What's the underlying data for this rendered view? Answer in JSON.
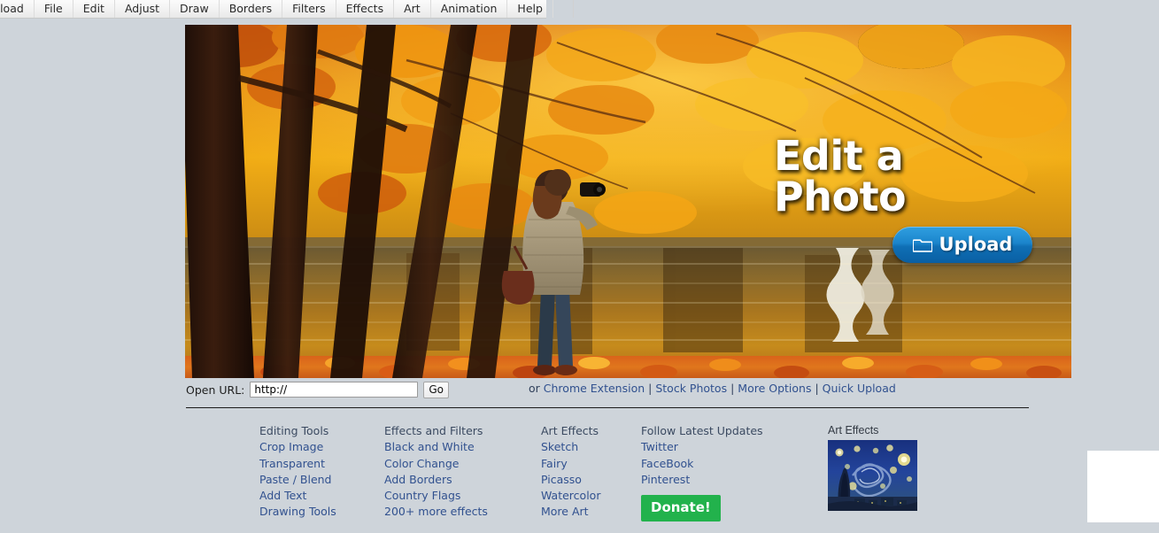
{
  "menubar": {
    "items": [
      {
        "label": "Upload",
        "name": "menu-upload"
      },
      {
        "label": "File",
        "name": "menu-file"
      },
      {
        "label": "Edit",
        "name": "menu-edit"
      },
      {
        "label": "Adjust",
        "name": "menu-adjust"
      },
      {
        "label": "Draw",
        "name": "menu-draw"
      },
      {
        "label": "Borders",
        "name": "menu-borders"
      },
      {
        "label": "Filters",
        "name": "menu-filters"
      },
      {
        "label": "Effects",
        "name": "menu-effects"
      },
      {
        "label": "Art",
        "name": "menu-art"
      },
      {
        "label": "Animation",
        "name": "menu-animation"
      },
      {
        "label": "Help",
        "name": "menu-help"
      }
    ]
  },
  "hero": {
    "title_line1": "Edit a",
    "title_line2": "Photo",
    "upload_button": "Upload",
    "upload_icon": "folder-icon",
    "alt": "autumn-lake-photographer-photo"
  },
  "url_row": {
    "label": "Open URL:",
    "value": "http://",
    "placeholder": "http://",
    "go_label": "Go",
    "prefix": "or",
    "links": [
      {
        "label": "Chrome Extension",
        "name": "chrome-extension-link"
      },
      {
        "label": "Stock Photos",
        "name": "stock-photos-link"
      },
      {
        "label": "More Options",
        "name": "more-options-link"
      },
      {
        "label": "Quick Upload",
        "name": "quick-upload-link"
      }
    ],
    "separator": "|"
  },
  "footer": {
    "columns": [
      {
        "heading": "Editing Tools",
        "links": [
          "Crop Image",
          "Transparent",
          "Paste / Blend",
          "Add Text",
          "Drawing Tools"
        ]
      },
      {
        "heading": "Effects and Filters",
        "links": [
          "Black and White",
          "Color Change",
          "Add Borders",
          "Country Flags",
          "200+ more effects"
        ]
      },
      {
        "heading": "Art Effects",
        "links": [
          "Sketch",
          "Fairy",
          "Picasso",
          "Watercolor",
          "More Art"
        ]
      },
      {
        "heading": "Follow Latest Updates",
        "links": [
          "Twitter",
          "FaceBook",
          "Pinterest"
        ]
      }
    ],
    "donate_label": "Donate!"
  },
  "art_effects": {
    "caption": "Art Effects",
    "thumb_alt": "starry-night-thumbnail"
  },
  "colors": {
    "page_background": "#ced4da",
    "link": "#31518f",
    "heading_text": "#3b4a61",
    "donate_green": "#22b24c",
    "upload_blue": "#1b85cc",
    "divider": "#1a1a1a",
    "ad_placeholder": "#ffffff"
  }
}
